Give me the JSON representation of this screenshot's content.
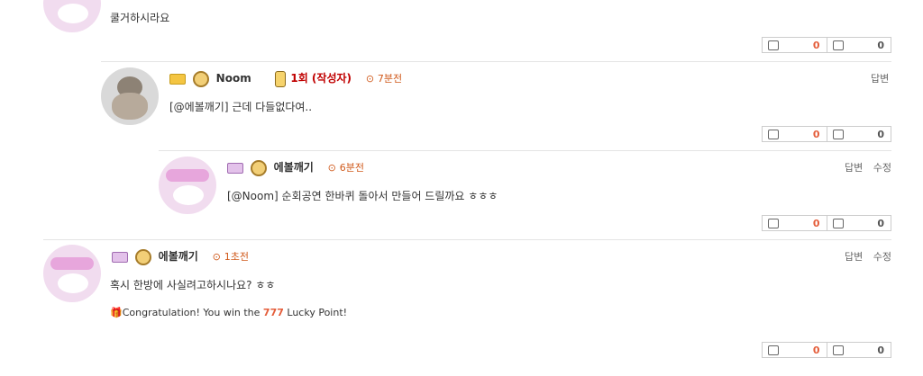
{
  "comments": [
    {
      "text": "쿨거하시라요",
      "votes": {
        "up": "0",
        "down": "0"
      }
    },
    {
      "nick": "Noom",
      "badge": "1회 (작성자)",
      "time": "7분전",
      "text": "[@에볼깨기] 근데 다들없다여..",
      "actions": [
        "답변"
      ],
      "votes": {
        "up": "0",
        "down": "0"
      }
    },
    {
      "nick": "에볼깨기",
      "time": "6분전",
      "text": "[@Noom] 순회공연 한바퀴 돌아서 만들어 드릴까요 ㅎㅎㅎ",
      "actions": [
        "답변",
        "수정"
      ],
      "votes": {
        "up": "0",
        "down": "0"
      }
    },
    {
      "nick": "에볼깨기",
      "time": "1초전",
      "text": "혹시 한방에 사실려고하시나요? ㅎㅎ",
      "lucky_prefix": "Congratulation! You win the ",
      "lucky_number": "777",
      "lucky_suffix": " Lucky Point!",
      "actions": [
        "답변",
        "수정"
      ],
      "votes": {
        "up": "0",
        "down": "0"
      }
    }
  ],
  "icons": {
    "clock": "clock-icon",
    "thumb_up": "thumbs-up-icon",
    "thumb_down": "thumbs-down-icon",
    "gift": "gift-icon"
  },
  "colors": {
    "accent": "#e45d3a",
    "author": "#c00000"
  }
}
